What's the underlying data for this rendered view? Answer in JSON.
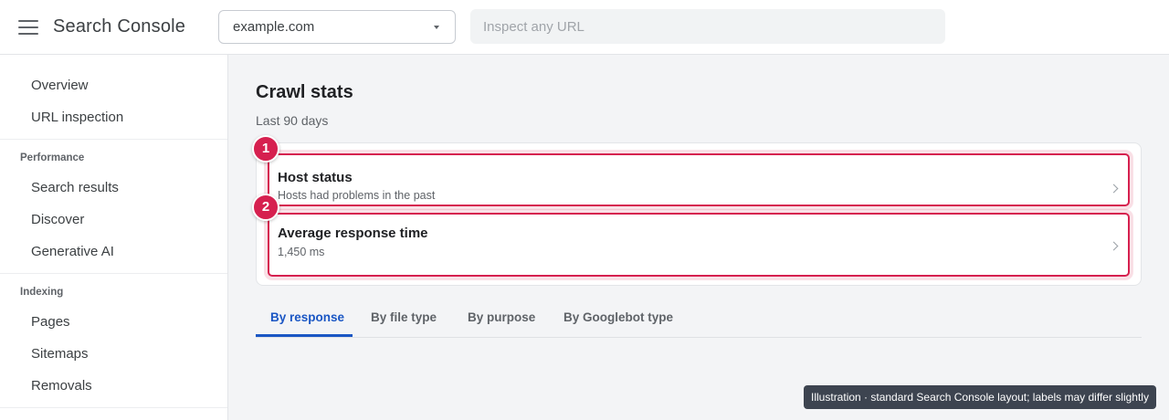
{
  "header": {
    "app_title": "Search Console",
    "property": "example.com",
    "inspect_placeholder": "Inspect any URL"
  },
  "sidebar": {
    "top_items": [
      {
        "label": "Overview"
      },
      {
        "label": "URL inspection"
      }
    ],
    "sections": [
      {
        "title": "Performance",
        "items": [
          {
            "label": "Search results"
          },
          {
            "label": "Discover"
          },
          {
            "label": "Generative AI"
          }
        ]
      },
      {
        "title": "Indexing",
        "items": [
          {
            "label": "Pages"
          },
          {
            "label": "Sitemaps"
          },
          {
            "label": "Removals"
          }
        ]
      }
    ]
  },
  "main": {
    "title": "Crawl stats",
    "subtitle": "Last 90 days",
    "stats": [
      {
        "marker": "1",
        "title": "Host status",
        "subtitle": "Hosts had problems in the past"
      },
      {
        "marker": "2",
        "title": "Average response time",
        "subtitle": "1,450 ms"
      }
    ],
    "tabs": [
      {
        "label": "By response",
        "active": true
      },
      {
        "label": "By file type",
        "active": false
      },
      {
        "label": "By purpose",
        "active": false
      },
      {
        "label": "By Googlebot type",
        "active": false
      }
    ]
  },
  "caption": "Illustration · standard Search Console layout; labels may differ slightly",
  "colors": {
    "accent": "#1a56c4",
    "highlight": "#d6204f",
    "main_background": "#f3f4f6"
  },
  "icons": [
    "menu-icon",
    "chevron-down-icon",
    "chevron-right-icon"
  ]
}
